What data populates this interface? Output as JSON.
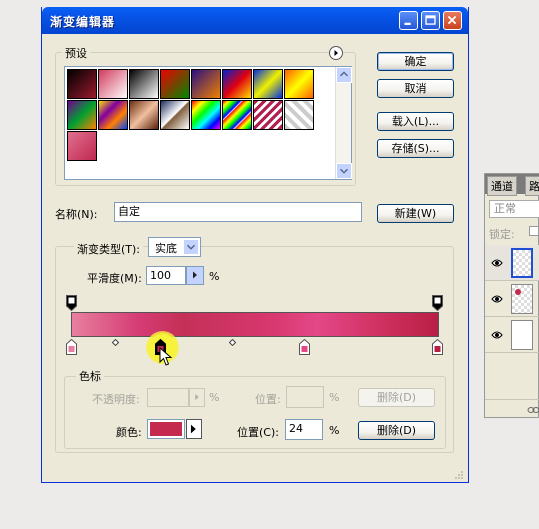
{
  "window": {
    "title": "渐变编辑器"
  },
  "presets": {
    "label": "预设",
    "swatches": [
      {
        "name": "foreground-background",
        "bg": "linear-gradient(135deg,#000 0%,#9b1a2e 100%)"
      },
      {
        "name": "fg-transparent",
        "bg": "linear-gradient(135deg,#d23a5c 0%,rgba(255,255,255,0) 100%)"
      },
      {
        "name": "black-white",
        "bg": "linear-gradient(135deg,#000 0%,#fff 100%)"
      },
      {
        "name": "red-green",
        "bg": "linear-gradient(135deg,#e00 0%,#080 100%)"
      },
      {
        "name": "violet-orange",
        "bg": "linear-gradient(135deg,#2a1080 0%,#f08000 100%)"
      },
      {
        "name": "blue-red-yellow",
        "bg": "linear-gradient(135deg,#0020d0 0%,#e00010 50%,#ffe000 100%)"
      },
      {
        "name": "blue-yellow-blue",
        "bg": "linear-gradient(135deg,#0030e0 0%,#f0f000 50%,#0030e0 100%)"
      },
      {
        "name": "orange-yellow-orange",
        "bg": "linear-gradient(135deg,#ff6000 0%,#ffff00 50%,#ff6000 100%)"
      },
      {
        "name": "violet-green-orange",
        "bg": "linear-gradient(135deg,#700090 0%,#00a030 50%,#ff8000 100%)"
      },
      {
        "name": "yellow-violet-orange-blue",
        "bg": "linear-gradient(135deg,#ffe000 0%,#8000a0 35%,#ff8000 65%,#0040ff 100%)"
      },
      {
        "name": "copper",
        "bg": "linear-gradient(135deg,#6a2f10 0%,#f0c0a0 50%,#5a2008 100%)"
      },
      {
        "name": "chrome",
        "bg": "linear-gradient(135deg,#203060 0%,#ffffff 48%,#806040 52%,#fff 100%)"
      },
      {
        "name": "spectrum",
        "bg": "linear-gradient(135deg,#f00,#ff0,#0f0,#0ff,#00f,#f0f)"
      },
      {
        "name": "transparent-rainbow",
        "bg": "repeating-linear-gradient(135deg,#f00 0,#ff0 4px,#0f0 8px,#00f 12px,#fff 14px)"
      },
      {
        "name": "transparent-stripes",
        "bg": "repeating-linear-gradient(135deg,#b02050 0,#b02050 3px,#fff 3px,#fff 6px)"
      },
      {
        "name": "neutral-density",
        "bg": "repeating-linear-gradient(45deg,#ccc 0,#ccc 4px,#fff 4px,#fff 8px)"
      },
      {
        "name": "custom-pink",
        "bg": "linear-gradient(135deg,#e07090 0%,#c02850 100%)"
      }
    ]
  },
  "buttons": {
    "ok": "确定",
    "cancel": "取消",
    "load": "载入(L)...",
    "save": "存储(S)...",
    "new": "新建(W)",
    "delete": "删除(D)",
    "delete_color": "删除(D)"
  },
  "name": {
    "label": "名称(N):",
    "value": "自定"
  },
  "gradient": {
    "type_label": "渐变类型(T):",
    "type_value": "实底",
    "smooth_label": "平滑度(M):",
    "smooth_value": "100",
    "percent": "%"
  },
  "color_stops": {
    "label": "色标",
    "opacity_label": "不透明度:",
    "opacity_value": "",
    "position_label": "位置:",
    "position_value": "",
    "percent": "%",
    "color_label": "颜色:",
    "color_value": "#c42a4e",
    "color_position_label": "位置(C):",
    "color_position_value": "24"
  },
  "side_panel": {
    "tab_channels": "通道",
    "tab_paths": "路",
    "blend_mode": "正常",
    "lock_label": "锁定:"
  },
  "colors": {
    "accent": "#0a5cf0",
    "stop_color": "#c42a4e"
  }
}
